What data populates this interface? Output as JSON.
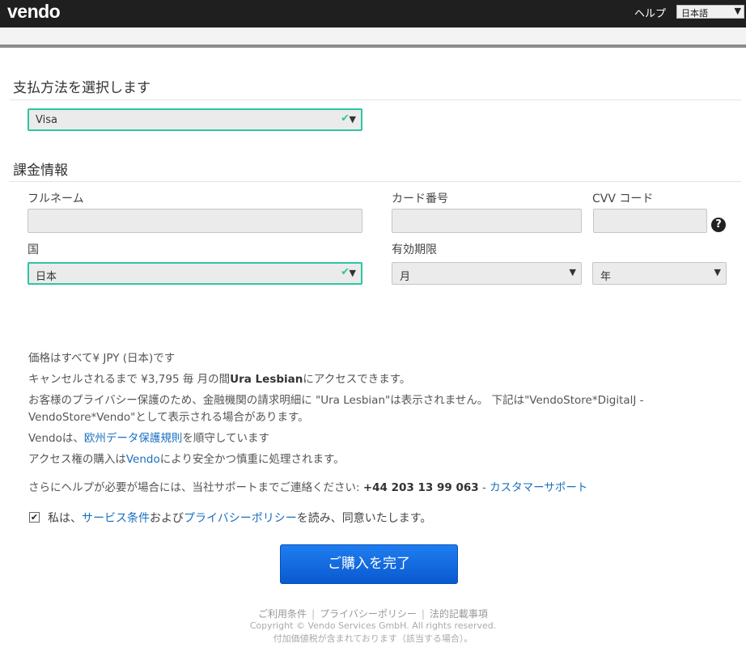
{
  "header": {
    "logo_text": "vendo",
    "help_label": "ヘルプ",
    "language_selected": "日本語"
  },
  "payment_method": {
    "title": "支払方法を選択します",
    "selected": "Visa"
  },
  "billing": {
    "title": "課金情報",
    "fullname_label": "フルネーム",
    "fullname_value": "",
    "card_number_label": "カード番号",
    "card_number_value": "",
    "cvv_label": "CVV コード",
    "cvv_value": "",
    "country_label": "国",
    "country_selected": "日本",
    "expiry_label": "有効期限",
    "month_selected": "月",
    "year_selected": "年"
  },
  "info": {
    "prices_line": "価格はすべて¥ JPY (日本)です",
    "access_prefix": "キャンセルされるまで ¥3,795 毎 月の間",
    "site_name": "Ura Lesbian",
    "access_suffix": "にアクセスできます。",
    "privacy_line1": "お客様のプライバシー保護のため、金融機関の請求明細に \"Ura Lesbian\"は表示されません。 下記は\"VendoStore*DigitalJ -",
    "privacy_line2": "VendoStore*Vendo\"として表示される場合があります。",
    "gdpr_prefix": "Vendoは、",
    "gdpr_link": "欧州データ保護規則",
    "gdpr_suffix": "を順守しています",
    "secure_prefix": "アクセス権の購入は",
    "secure_link": "Vendo",
    "secure_suffix": "により安全かつ慎重に処理されます。",
    "support_prefix": "さらにヘルプが必要が場合には、当社サポートまでご連絡ください: ",
    "support_phone": "+44 203 13 99 063",
    "support_dash": " - ",
    "support_link": "カスタマーサポート"
  },
  "agreement": {
    "checked": true,
    "prefix": "私は、",
    "terms_link": "サービス条件",
    "and": "および",
    "privacy_link": "プライバシーポリシー",
    "suffix": "を読み、同意いたします。"
  },
  "submit_label": "ご購入を完了",
  "footer": {
    "terms": "ご利用条件",
    "privacy": "プライバシーポリシー",
    "legal": "法的記載事項",
    "copyright": "Copyright © Vendo Services GmbH. All rights reserved.",
    "tax_note": "付加価値税が含まれております（該当する場合）。"
  }
}
